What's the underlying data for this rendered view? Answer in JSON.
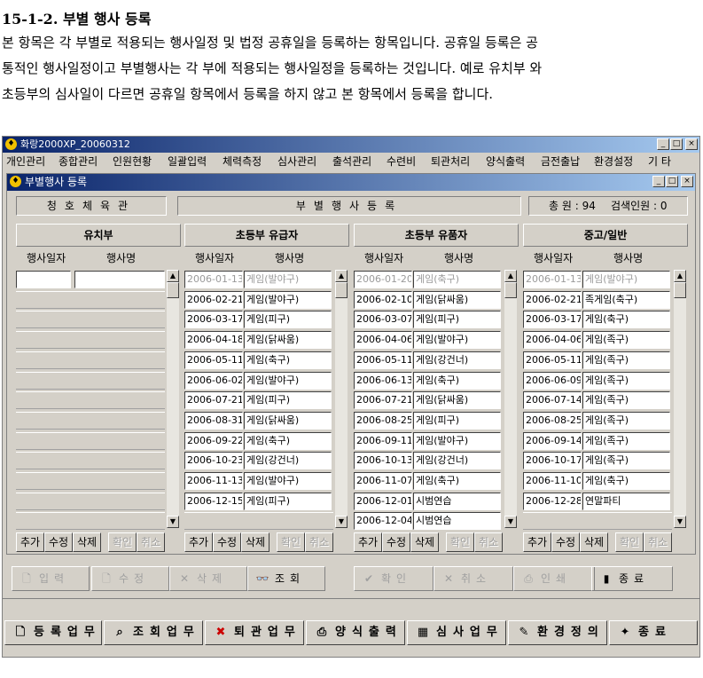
{
  "doc": {
    "title": "15-1-2. 부별 행사 등록",
    "lines": [
      "본 항목은 각 부별로 적용되는 행사일정 및 법정 공휴일을 등록하는 항목입니다. 공휴일 등록은 공",
      "통적인 행사일정이고 부별행사는 각 부에 적용되는 행사일정을 등록하는 것입니다. 예로 유치부 와",
      "초등부의 심사일이 다르면 공휴일 항목에서 등록을 하지 않고 본 항목에서 등록을 합니다."
    ]
  },
  "app": {
    "title": "화랑2000XP_20060312",
    "menu": [
      "개인관리",
      "종합관리",
      "인원현황",
      "일괄입력",
      "체력측정",
      "심사관리",
      "출석관리",
      "수련비",
      "퇴관처리",
      "양식출력",
      "금전출납",
      "환경설정",
      "기 타"
    ]
  },
  "child": {
    "title": "부별행사 등록",
    "gym_name": "청호체육관",
    "section_title": "부별행사등록",
    "total_label": "총 원 : 94",
    "search_label": "검색인원 : 0"
  },
  "panels": [
    {
      "title": "유치부",
      "col_date": "행사일자",
      "col_name": "행사명",
      "rows": [
        {
          "date": "",
          "name": ""
        }
      ]
    },
    {
      "title": "초등부 유급자",
      "col_date": "행사일자",
      "col_name": "행사명",
      "rows": [
        {
          "date": "2006-01-13",
          "name": "게임(발야구)"
        },
        {
          "date": "2006-02-21",
          "name": "게임(발야구)"
        },
        {
          "date": "2006-03-17",
          "name": "게임(피구)"
        },
        {
          "date": "2006-04-18",
          "name": "게임(닭싸움)"
        },
        {
          "date": "2006-05-11",
          "name": "게임(축구)"
        },
        {
          "date": "2006-06-02",
          "name": "게임(발야구)"
        },
        {
          "date": "2006-07-21",
          "name": "게임(피구)"
        },
        {
          "date": "2006-08-31",
          "name": "게임(닭싸움)"
        },
        {
          "date": "2006-09-22",
          "name": "게임(축구)"
        },
        {
          "date": "2006-10-23",
          "name": "게임(강건너)"
        },
        {
          "date": "2006-11-13",
          "name": "게임(발야구)"
        },
        {
          "date": "2006-12-15",
          "name": "게임(피구)"
        }
      ]
    },
    {
      "title": "초등부 유품자",
      "col_date": "행사일자",
      "col_name": "행사명",
      "rows": [
        {
          "date": "2006-01-20",
          "name": "게임(축구)"
        },
        {
          "date": "2006-02-10",
          "name": "게임(닭싸움)"
        },
        {
          "date": "2006-03-07",
          "name": "게임(피구)"
        },
        {
          "date": "2006-04-06",
          "name": "게임(발야구)"
        },
        {
          "date": "2006-05-11",
          "name": "게임(강건너)"
        },
        {
          "date": "2006-06-13",
          "name": "게임(축구)"
        },
        {
          "date": "2006-07-21",
          "name": "게임(닭싸움)"
        },
        {
          "date": "2006-08-25",
          "name": "게임(피구)"
        },
        {
          "date": "2006-09-11",
          "name": "게임(발야구)"
        },
        {
          "date": "2006-10-13",
          "name": "게임(강건너)"
        },
        {
          "date": "2006-11-07",
          "name": "게임(축구)"
        },
        {
          "date": "2006-12-01",
          "name": "시범연습"
        },
        {
          "date": "2006-12-04",
          "name": "시범연습"
        }
      ]
    },
    {
      "title": "중고/일반",
      "col_date": "행사일자",
      "col_name": "행사명",
      "rows": [
        {
          "date": "2006-01-13",
          "name": "게임(발야구)"
        },
        {
          "date": "2006-02-21",
          "name": "족게임(축구)"
        },
        {
          "date": "2006-03-17",
          "name": "게임(축구)"
        },
        {
          "date": "2006-04-06",
          "name": "게임(족구)"
        },
        {
          "date": "2006-05-11",
          "name": "게임(족구)"
        },
        {
          "date": "2006-06-09",
          "name": "게임(족구)"
        },
        {
          "date": "2006-07-14",
          "name": "게임(족구)"
        },
        {
          "date": "2006-08-25",
          "name": "게임(족구)"
        },
        {
          "date": "2006-09-14",
          "name": "게임(족구)"
        },
        {
          "date": "2006-10-17",
          "name": "게임(족구)"
        },
        {
          "date": "2006-11-10",
          "name": "게임(축구)"
        },
        {
          "date": "2006-12-28",
          "name": "연말파티"
        }
      ]
    }
  ],
  "panel_buttons": [
    "추가",
    "수정",
    "삭제",
    "확인",
    "취소"
  ],
  "toolbar": [
    {
      "label": "입력",
      "icon": "new-doc-icon",
      "glyph": "🗋",
      "enabled": false
    },
    {
      "label": "수정",
      "icon": "edit-doc-icon",
      "glyph": "🗋",
      "enabled": false
    },
    {
      "label": "삭제",
      "icon": "delete-x-icon",
      "glyph": "✕",
      "enabled": false
    },
    {
      "label": "조회",
      "icon": "binoculars-icon",
      "glyph": "👓",
      "enabled": true
    },
    {
      "label": "확인",
      "icon": "check-icon",
      "glyph": "✔",
      "enabled": false
    },
    {
      "label": "취소",
      "icon": "cancel-icon",
      "glyph": "✕",
      "enabled": false
    },
    {
      "label": "인쇄",
      "icon": "printer-icon",
      "glyph": "⎙",
      "enabled": false
    },
    {
      "label": "종료",
      "icon": "exit-door-icon",
      "glyph": "▮",
      "enabled": true
    }
  ],
  "bottombar": [
    {
      "label": "등록업무",
      "icon": "document-icon",
      "glyph": "🗋"
    },
    {
      "label": "조회업무",
      "icon": "search-icon",
      "glyph": "⌕"
    },
    {
      "label": "퇴관업무",
      "icon": "red-x-icon",
      "glyph": "✖"
    },
    {
      "label": "양식출력",
      "icon": "printer-icon",
      "glyph": "⎙"
    },
    {
      "label": "심사업무",
      "icon": "calculator-icon",
      "glyph": "▦"
    },
    {
      "label": "환경정의",
      "icon": "settings-icon",
      "glyph": "✎"
    },
    {
      "label": "종료",
      "icon": "exit-icon",
      "glyph": "✦"
    }
  ],
  "colors": {
    "title_active": "#0a246a",
    "face": "#d4d0c8",
    "disabled_text": "#9a9a9a",
    "red": "#cc0000"
  }
}
